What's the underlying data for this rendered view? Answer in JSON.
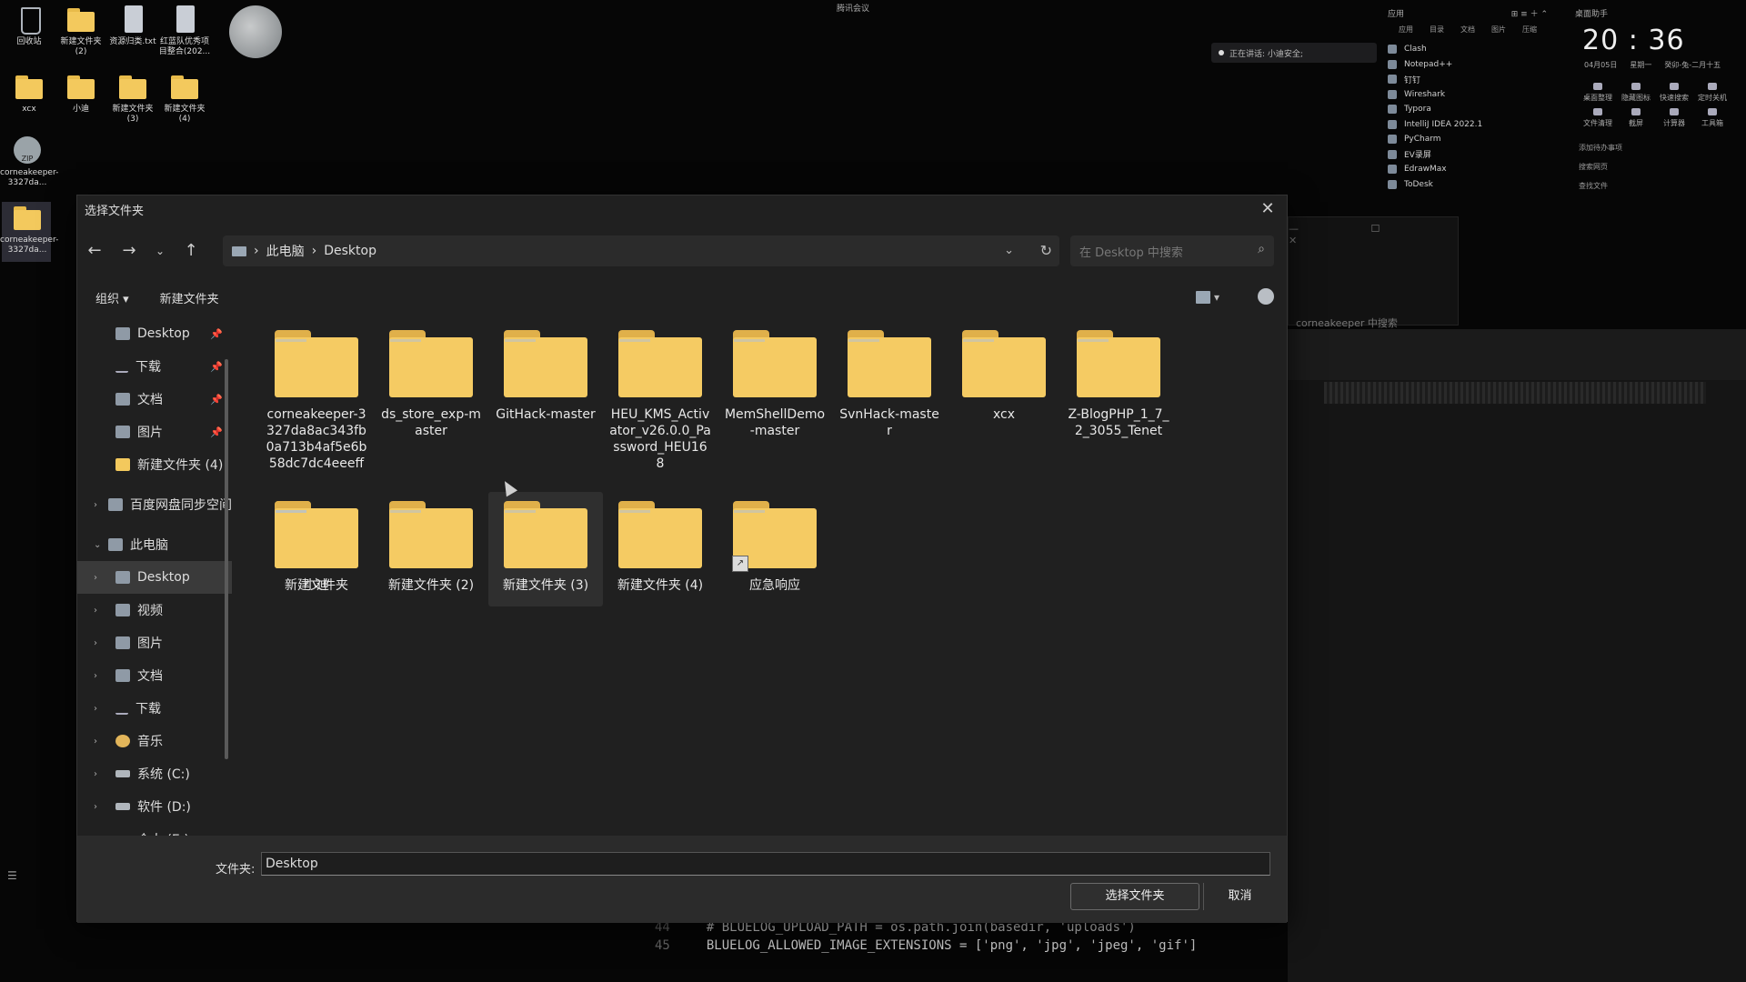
{
  "desktop": {
    "icons_row1": [
      {
        "label": "回收站",
        "kind": "bin"
      },
      {
        "label": "新建文件夹 (2)",
        "kind": "folder"
      },
      {
        "label": "资源归类.txt",
        "kind": "file"
      },
      {
        "label": "红蓝队优秀项目整合(202...",
        "kind": "file"
      }
    ],
    "icons_row2": [
      {
        "label": "xcx",
        "kind": "folder"
      },
      {
        "label": "小迪",
        "kind": "folder"
      },
      {
        "label": "新建文件夹 (3)",
        "kind": "folder"
      },
      {
        "label": "新建文件夹 (4)",
        "kind": "folder"
      }
    ],
    "icons_col": [
      {
        "label": "corneakeeper-3327da...",
        "kind": "zip"
      },
      {
        "label": "corneakeeper-3327da...",
        "kind": "folder"
      }
    ]
  },
  "topbar": {
    "meeting": "腾讯会议"
  },
  "notification": {
    "text": "正在讲话: 小迪安全;"
  },
  "launcher": {
    "title": "应用",
    "tabs": [
      "应用",
      "目录",
      "文档",
      "图片",
      "压缩"
    ],
    "items": [
      "Clash",
      "Notepad++",
      "钉钉",
      "Wireshark",
      "Typora",
      "IntelliJ IDEA 2022.1",
      "PyCharm",
      "EV录屏",
      "EdrawMax",
      "ToDesk"
    ]
  },
  "clock": {
    "title": "桌面助手",
    "time": "20 : 36",
    "date": "04月05日",
    "weekday": "星期一",
    "lunar": "癸卯-兔-二月十五",
    "tools": [
      "桌面整理",
      "隐藏图标",
      "快速搜索",
      "定时关机",
      "文件清理",
      "截屏",
      "计算器",
      "工具箱"
    ],
    "links": [
      "添加待办事项",
      "搜索网页",
      "查找文件"
    ]
  },
  "code": {
    "lines": [
      {
        "n": "44",
        "t": "  # BLUELOG_UPLOAD_PATH = os.path.join(basedir, 'uploads')"
      },
      {
        "n": "45",
        "t": "  BLUELOG_ALLOWED_IMAGE_EXTENSIONS = ['png', 'jpg', 'jpeg', 'gif']"
      }
    ]
  },
  "bg_window": {
    "search_text": "corneakeeper 中搜索"
  },
  "dialog": {
    "title": "选择文件夹",
    "breadcrumb": [
      "此电脑",
      "Desktop"
    ],
    "search_placeholder": "在 Desktop 中搜索",
    "organize": "组织 ▾",
    "new_folder": "新建文件夹",
    "nav_quick": [
      {
        "label": "Desktop",
        "icon": "desktop",
        "pin": true
      },
      {
        "label": "下载",
        "icon": "download",
        "pin": true
      },
      {
        "label": "文档",
        "icon": "documents",
        "pin": true
      },
      {
        "label": "图片",
        "icon": "pictures",
        "pin": true
      },
      {
        "label": "新建文件夹 (4)",
        "icon": "folder",
        "pin": false
      }
    ],
    "nav_cloud": "百度网盘同步空间",
    "nav_pc": "此电脑",
    "nav_pc_children": [
      {
        "label": "Desktop",
        "icon": "desktop",
        "selected": true
      },
      {
        "label": "视频",
        "icon": "videos"
      },
      {
        "label": "图片",
        "icon": "pictures"
      },
      {
        "label": "文档",
        "icon": "documents"
      },
      {
        "label": "下载",
        "icon": "download"
      },
      {
        "label": "音乐",
        "icon": "music"
      },
      {
        "label": "系统 (C:)",
        "icon": "drive"
      },
      {
        "label": "软件 (D:)",
        "icon": "drive"
      },
      {
        "label": "个人 (E:)",
        "icon": "drive"
      }
    ],
    "folders_row1": [
      "corneakeeper-3327da8ac343fb0a713b4af5e6b58dc7dc4eeeff",
      "ds_store_exp-master",
      "GitHack-master",
      "HEU_KMS_Activator_v26.0.0_Password_HEU168",
      "MemShellDemo-master",
      "SvnHack-master",
      "xcx",
      "Z-BlogPHP_1_7_2_3055_Tenet",
      "小迪"
    ],
    "folders_row2": [
      {
        "label": "新建文件夹",
        "shortcut": false
      },
      {
        "label": "新建文件夹 (2)",
        "shortcut": false
      },
      {
        "label": "新建文件夹 (3)",
        "shortcut": false,
        "hover": true
      },
      {
        "label": "新建文件夹 (4)",
        "shortcut": false
      },
      {
        "label": "应急响应",
        "shortcut": true
      }
    ],
    "folder_label": "文件夹:",
    "folder_value": "Desktop",
    "ok_button": "选择文件夹",
    "cancel_button": "取消"
  }
}
